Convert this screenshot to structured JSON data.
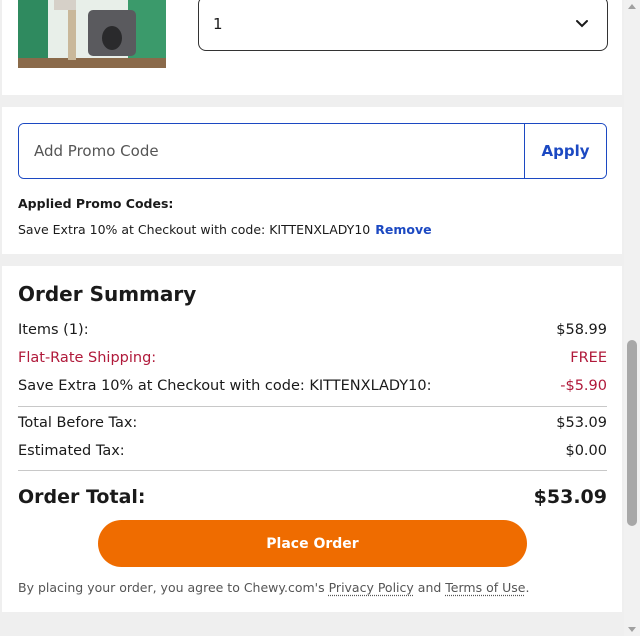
{
  "product": {
    "quantity_value": "1",
    "image_icon": "cat-tree-product-image"
  },
  "promo": {
    "placeholder": "Add Promo Code",
    "apply_label": "Apply",
    "applied_title": "Applied Promo Codes:",
    "applied_code_text": "Save Extra 10% at Checkout with code: KITTENXLADY10",
    "remove_label": "Remove"
  },
  "summary": {
    "title": "Order Summary",
    "items_label": "Items (1):",
    "items_value": "$58.99",
    "shipping_label": "Flat-Rate Shipping:",
    "shipping_value": "FREE",
    "discount_label": "Save Extra 10% at Checkout with code: KITTENXLADY10:",
    "discount_value": "-$5.90",
    "before_tax_label": "Total Before Tax:",
    "before_tax_value": "$53.09",
    "tax_label": "Estimated Tax:",
    "tax_value": "$0.00",
    "total_label": "Order Total:",
    "total_value": "$53.09",
    "place_order_label": "Place Order",
    "legal_prefix": "By placing your order, you agree to Chewy.com's",
    "privacy_label": "Privacy Policy",
    "legal_and": "and",
    "terms_label": "Terms of Use",
    "legal_suffix": "."
  },
  "colors": {
    "accent_blue": "#1c49c2",
    "discount_red": "#b0193a",
    "place_order_orange": "#ef6c00"
  }
}
